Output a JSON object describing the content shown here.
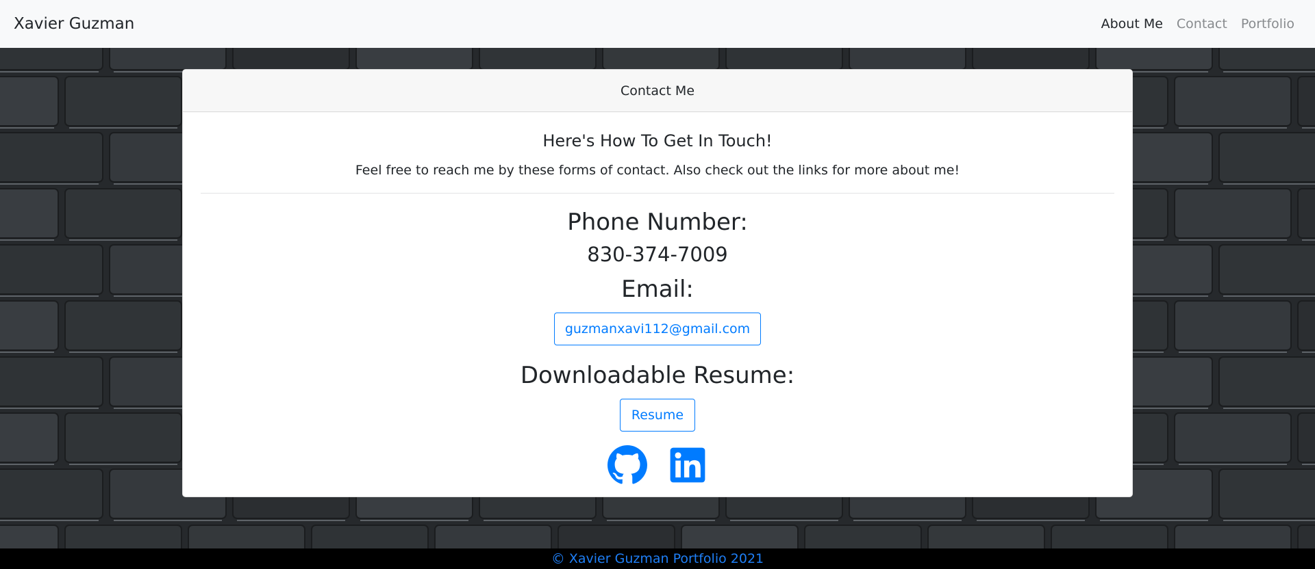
{
  "navbar": {
    "brand": "Xavier Guzman",
    "links": [
      {
        "label": "About Me",
        "active": true
      },
      {
        "label": "Contact",
        "active": false
      },
      {
        "label": "Portfolio",
        "active": false
      }
    ]
  },
  "card": {
    "header": "Contact Me",
    "title": "Here's How To Get In Touch!",
    "text": "Feel free to reach me by these forms of contact. Also check out the links for more about me!",
    "phone_heading": "Phone Number:",
    "phone": "830-374-7009",
    "email_heading": "Email:",
    "email": "guzmanxavi112@gmail.com",
    "resume_heading": "Downloadable Resume:",
    "resume_button": "Resume",
    "icons": [
      "github-icon",
      "linkedin-icon"
    ]
  },
  "footer": {
    "copyright_symbol": "©",
    "text": "Xavier Guzman Portfolio 2021"
  },
  "colors": {
    "accent": "#007bff",
    "navbar_bg": "#f8f9fa",
    "footer_bg": "#000000",
    "footer_text": "#1f7ff6"
  }
}
